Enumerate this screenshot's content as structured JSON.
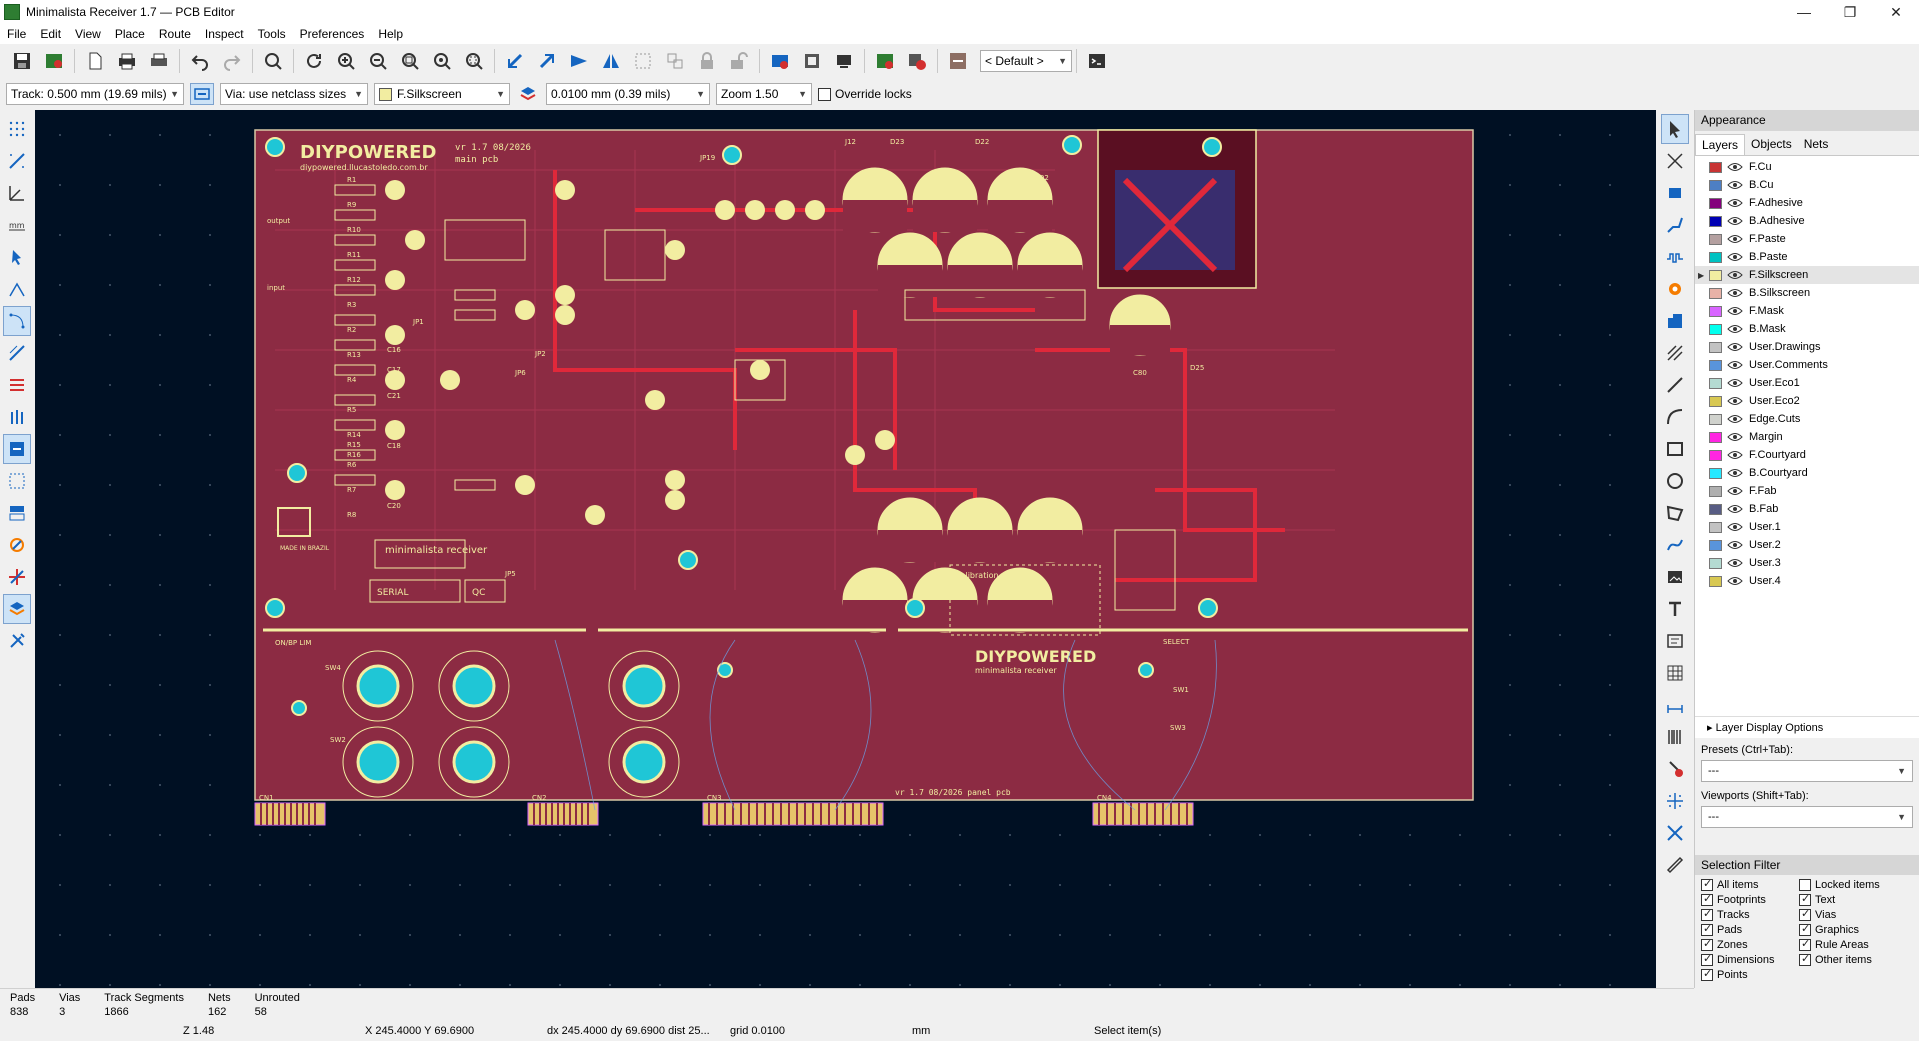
{
  "window": {
    "title": "Minimalista Receiver 1.7 — PCB Editor",
    "controls": [
      "—",
      "❐",
      "✕"
    ]
  },
  "menu": [
    "File",
    "Edit",
    "View",
    "Place",
    "Route",
    "Inspect",
    "Tools",
    "Preferences",
    "Help"
  ],
  "toolbar": {
    "icons": [
      "save-icon",
      "board-setup-icon",
      "page-setup-icon",
      "print-icon",
      "plot-icon",
      "undo-icon",
      "redo-icon",
      "find-icon",
      "refresh-icon",
      "zoom-in-icon",
      "zoom-out-icon",
      "zoom-fit-icon",
      "zoom-objects-icon",
      "zoom-selection-icon",
      "rotate-ccw-icon",
      "rotate-cw-icon",
      "flip-icon",
      "mirror-icon",
      "group-icon",
      "ungroup-icon",
      "lock-icon",
      "unlock-icon",
      "netlist-icon",
      "footprint-editor-icon",
      "footprint-viewer-icon",
      "3d-viewer-icon",
      "drc-icon",
      "layer-pair-icon",
      "scripting-console-icon"
    ],
    "layer_preset": "< Default >"
  },
  "aux": {
    "track": "Track: 0.500 mm (19.69 mils)",
    "via": "Via: use netclass sizes",
    "layer": "F.Silkscreen",
    "grid": "0.0100 mm (0.39 mils)",
    "zoom": "Zoom 1.50",
    "override_locks": "Override locks"
  },
  "board": {
    "brand_top": "DIYPOWERED",
    "brand_url": "diypowered.llucastoledo.com.br",
    "version_main": "vr 1.7 08/2026",
    "main_pcb": "main pcb",
    "product": "minimalista receiver",
    "serial": "SERIAL",
    "qc": "QC",
    "made_in": "MADE IN BRAZIL",
    "brand_panel": "DIYPOWERED",
    "panel_product": "minimalista receiver",
    "version_panel": "vr 1.7 08/2026 panel pcb",
    "calibration_title": "Calibration",
    "labels": [
      "R1",
      "R2",
      "R3",
      "R4",
      "R5",
      "R6",
      "R7",
      "R8",
      "R9",
      "R10",
      "R11",
      "R12",
      "R13",
      "R14",
      "R15",
      "R16",
      "C16",
      "C17",
      "C18",
      "C19",
      "C20",
      "C21",
      "JP1",
      "JP2",
      "JP5",
      "JP6",
      "JP19",
      "J12",
      "D22",
      "D23",
      "R92",
      "C80",
      "D25",
      "CN1",
      "CN2",
      "CN3",
      "CN4",
      "SW1",
      "SW2",
      "SW3",
      "SW4",
      "SELECT",
      "ON/BP LIM",
      "output",
      "input"
    ]
  },
  "appearance": {
    "title": "Appearance",
    "tabs": [
      "Layers",
      "Objects",
      "Nets"
    ],
    "layers": [
      {
        "name": "F.Cu",
        "color": "#c83434"
      },
      {
        "name": "B.Cu",
        "color": "#4d7fc4"
      },
      {
        "name": "F.Adhesive",
        "color": "#84007c"
      },
      {
        "name": "B.Adhesive",
        "color": "#0000b4"
      },
      {
        "name": "F.Paste",
        "color": "#b4a0a0"
      },
      {
        "name": "B.Paste",
        "color": "#00c2c2"
      },
      {
        "name": "F.Silkscreen",
        "color": "#f2eda1"
      },
      {
        "name": "B.Silkscreen",
        "color": "#e8b2a7"
      },
      {
        "name": "F.Mask",
        "color": "#d864ff"
      },
      {
        "name": "B.Mask",
        "color": "#02ffee"
      },
      {
        "name": "User.Drawings",
        "color": "#c2c2c2"
      },
      {
        "name": "User.Comments",
        "color": "#5994dc"
      },
      {
        "name": "User.Eco1",
        "color": "#b4dbd2"
      },
      {
        "name": "User.Eco2",
        "color": "#d8c852"
      },
      {
        "name": "Edge.Cuts",
        "color": "#d0d2cd"
      },
      {
        "name": "Margin",
        "color": "#ff26e2"
      },
      {
        "name": "F.Courtyard",
        "color": "#ff26e2"
      },
      {
        "name": "B.Courtyard",
        "color": "#26e9ff"
      },
      {
        "name": "F.Fab",
        "color": "#afafaf"
      },
      {
        "name": "B.Fab",
        "color": "#58 5d84"
      },
      {
        "name": "User.1",
        "color": "#c2c2c2"
      },
      {
        "name": "User.2",
        "color": "#5994dc"
      },
      {
        "name": "User.3",
        "color": "#b4dbd2"
      },
      {
        "name": "User.4",
        "color": "#d8c852"
      }
    ],
    "selected_layer": "F.Silkscreen",
    "layer_display_options": "Layer Display Options",
    "presets_label": "Presets (Ctrl+Tab):",
    "presets_value": "---",
    "viewports_label": "Viewports (Shift+Tab):",
    "viewports_value": "---"
  },
  "selection_filter": {
    "title": "Selection Filter",
    "items": [
      {
        "label": "All items",
        "checked": true
      },
      {
        "label": "Locked items",
        "checked": false
      },
      {
        "label": "Footprints",
        "checked": true
      },
      {
        "label": "Text",
        "checked": true
      },
      {
        "label": "Tracks",
        "checked": true
      },
      {
        "label": "Vias",
        "checked": true
      },
      {
        "label": "Pads",
        "checked": true
      },
      {
        "label": "Graphics",
        "checked": true
      },
      {
        "label": "Zones",
        "checked": true
      },
      {
        "label": "Rule Areas",
        "checked": true
      },
      {
        "label": "Dimensions",
        "checked": true
      },
      {
        "label": "Other items",
        "checked": true
      },
      {
        "label": "Points",
        "checked": true
      }
    ]
  },
  "status": {
    "stats": [
      {
        "label": "Pads",
        "value": "838"
      },
      {
        "label": "Vias",
        "value": "3"
      },
      {
        "label": "Track Segments",
        "value": "1866"
      },
      {
        "label": "Nets",
        "value": "162"
      },
      {
        "label": "Unrouted",
        "value": "58"
      }
    ],
    "zoom": "Z 1.48",
    "coords": "X 245.4000  Y 69.6900",
    "delta": "dx 245.4000  dy 69.6900  dist 25...",
    "grid": "grid 0.0100",
    "units": "mm",
    "message": "Select item(s)"
  }
}
